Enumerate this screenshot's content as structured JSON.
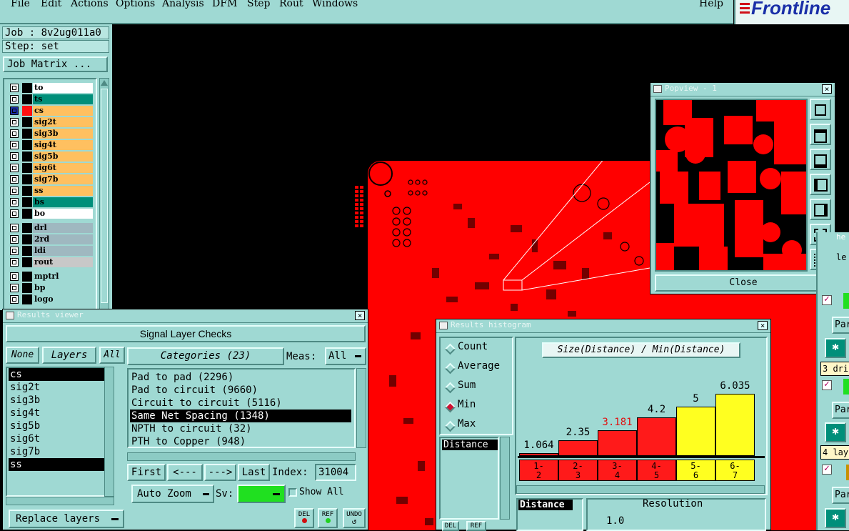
{
  "menu": {
    "items": [
      "File",
      "Edit",
      "Actions",
      "Options",
      "Analysis",
      "DFM",
      "Step",
      "Rout",
      "Windows"
    ],
    "help": "Help",
    "brand": "Frontline"
  },
  "job": {
    "job_line": "Job : 8v2ug011a0",
    "step_line": "Step: set",
    "matrix_button": "Job Matrix ..."
  },
  "layers": [
    {
      "name": "to",
      "color": "#ffffff",
      "sel": false
    },
    {
      "name": "ts",
      "color": "#008f7a",
      "sel": false
    },
    {
      "name": "cs",
      "color": "#ffc060",
      "sel": true
    },
    {
      "name": "sig2t",
      "color": "#ffc060",
      "sel": false
    },
    {
      "name": "sig3b",
      "color": "#ffc060",
      "sel": false
    },
    {
      "name": "sig4t",
      "color": "#ffc060",
      "sel": false
    },
    {
      "name": "sig5b",
      "color": "#ffc060",
      "sel": false
    },
    {
      "name": "sig6t",
      "color": "#ffc060",
      "sel": false
    },
    {
      "name": "sig7b",
      "color": "#ffc060",
      "sel": false
    },
    {
      "name": "ss",
      "color": "#ffc060",
      "sel": false
    },
    {
      "name": "bs",
      "color": "#008f7a",
      "sel": false
    },
    {
      "name": "bo",
      "color": "#ffffff",
      "sel": false
    },
    {
      "name": "drl",
      "color": "#9fb8c0",
      "sel": false
    },
    {
      "name": "2rd",
      "color": "#9fb8c0",
      "sel": false
    },
    {
      "name": "ldi",
      "color": "#9fb8c0",
      "sel": false
    },
    {
      "name": "rout",
      "color": "#c8c8c8",
      "sel": false
    },
    {
      "name": "mptrl",
      "color": "#9fd9d3",
      "sel": false
    },
    {
      "name": "bp",
      "color": "#9fd9d3",
      "sel": false
    },
    {
      "name": "logo",
      "color": "#9fd9d3",
      "sel": false
    }
  ],
  "results_viewer": {
    "title": "Results viewer",
    "header": "Signal Layer Checks",
    "none_btn": "None",
    "layers_btn": "Layers",
    "all_btn": "All",
    "layer_list": [
      "cs",
      "sig2t",
      "sig3b",
      "sig4t",
      "sig5b",
      "sig6t",
      "sig7b",
      "ss"
    ],
    "layer_selected": [
      "cs",
      "ss"
    ],
    "categories_btn": "Categories (23)",
    "meas_label": "Meas:",
    "meas_value": "All",
    "categories": [
      "Pad to pad (2296)",
      "Pad to circuit (9660)",
      "Circuit to circuit (5116)",
      "Same Net Spacing (1348)",
      "NPTH to circuit (32)",
      "PTH to Copper (948)"
    ],
    "selected_category": "Same Net Spacing (1348)",
    "first": "First",
    "prev": "<---",
    "next": "--->",
    "last": "Last",
    "index_label": "Index:",
    "index_value": "31004",
    "auto_zoom": "Auto Zoom",
    "sv_label": "Sv:",
    "show_all": "Show All",
    "replace_layers": "Replace layers",
    "del": "DEL",
    "ref": "REF",
    "undo": "UNDO"
  },
  "popview": {
    "title": "Popview - 1",
    "close": "Close"
  },
  "histogram": {
    "title": "Results histogram",
    "options": [
      "Count",
      "Average",
      "Sum",
      "Min",
      "Max"
    ],
    "selected_option": "Min",
    "list_item": "Distance",
    "header": "Size(Distance) / Min(Distance)",
    "footer_left": "Distance",
    "resolution_label": "Resolution",
    "resolution_value": "1.0",
    "del": "DEL",
    "ref": "REF"
  },
  "chart_data": {
    "type": "bar",
    "title": "Size(Distance) / Min(Distance)",
    "categories": [
      "1-2",
      "2-3",
      "3-4",
      "4-5",
      "5-6",
      "6-7"
    ],
    "values": [
      1.064,
      2.35,
      3.181,
      4.2,
      5,
      6.035
    ],
    "value_labels": [
      "1.064",
      "2.35",
      "3.181",
      "4.2",
      "5",
      "6.035"
    ],
    "colors": [
      "#ff1a1a",
      "#ff1a1a",
      "#ff1a1a",
      "#ff1a1a",
      "#ffff20",
      "#ffff20"
    ],
    "highlight_label_color": "#e01010",
    "highlight_index": 2
  },
  "right_panel": {
    "labels": [
      "Par",
      "Par",
      "Par"
    ],
    "field1": "3 dri",
    "field2": "4 lay",
    "partial": "he",
    "partial2": "le"
  }
}
